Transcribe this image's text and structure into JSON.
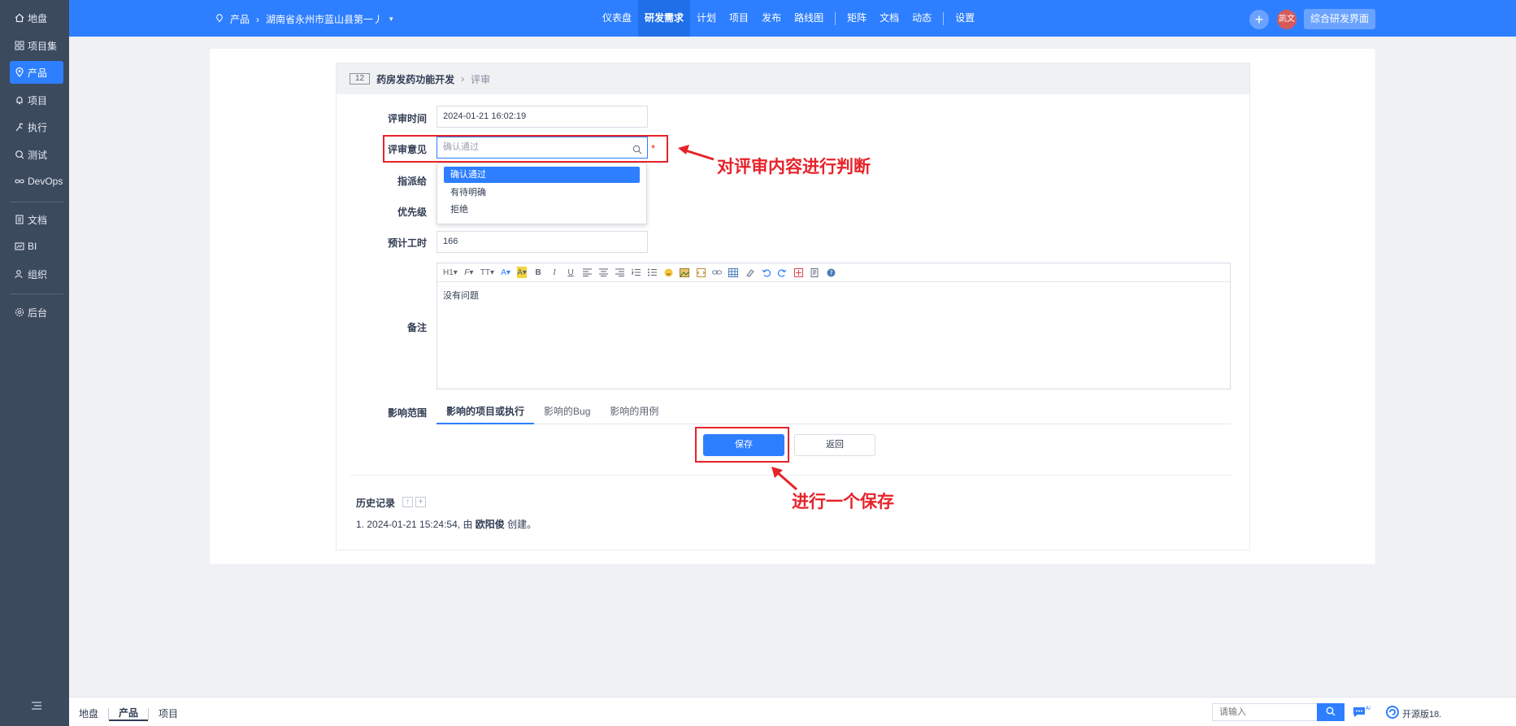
{
  "sidebar": {
    "items": [
      {
        "label": "地盘"
      },
      {
        "label": "项目集"
      },
      {
        "label": "产品"
      },
      {
        "label": "项目"
      },
      {
        "label": "执行"
      },
      {
        "label": "测试"
      },
      {
        "label": "DevOps"
      },
      {
        "label": "文档"
      },
      {
        "label": "BI"
      },
      {
        "label": "组织"
      },
      {
        "label": "后台"
      }
    ],
    "active": "产品"
  },
  "topbar": {
    "section": "产品",
    "product": "湖南省永州市蓝山县第一丿",
    "menu": [
      "仪表盘",
      "研发需求",
      "计划",
      "项目",
      "发布",
      "路线图",
      "矩阵",
      "文档",
      "动态",
      "设置"
    ],
    "active_menu": "研发需求",
    "user": "凯文",
    "workspace": "综合研发界面"
  },
  "panel": {
    "id": "12",
    "title": "药房发药功能开发",
    "sub": "评审"
  },
  "form": {
    "review_time_label": "评审时间",
    "review_time_value": "2024-01-21 16:02:19",
    "review_opinion_label": "评审意见",
    "review_opinion_placeholder": "确认通过",
    "required_mark": "*",
    "assign_label": "指派给",
    "priority_label": "优先级",
    "estimate_label": "预计工时",
    "estimate_value": "166",
    "remark_label": "备注",
    "remark_value": "没有问题",
    "scope_label": "影响范围"
  },
  "dropdown": {
    "options": [
      "确认通过",
      "有待明确",
      "拒绝"
    ],
    "selected": "确认通过"
  },
  "editor_toolbar": [
    "H1",
    "F",
    "TT",
    "A",
    "A",
    "B",
    "I",
    "U"
  ],
  "tabs": [
    "影响的项目或执行",
    "影响的Bug",
    "影响的用例"
  ],
  "buttons": {
    "save": "保存",
    "back": "返回"
  },
  "history": {
    "title": "历史记录",
    "entry_prefix": "1. 2024-01-21 15:24:54, 由 ",
    "entry_user": "欧阳俊",
    "entry_suffix": " 创建。"
  },
  "annotations": {
    "judge": "对评审内容进行判断",
    "save": "进行一个保存"
  },
  "bottombar": {
    "nav": [
      "地盘",
      "产品",
      "项目"
    ],
    "active": "产品",
    "search_placeholder": "请输入",
    "open_source": "开源版18."
  },
  "colors": {
    "primary": "#2e7fff",
    "sidebar": "#3c4a5e",
    "annotation": "#e6232a"
  }
}
